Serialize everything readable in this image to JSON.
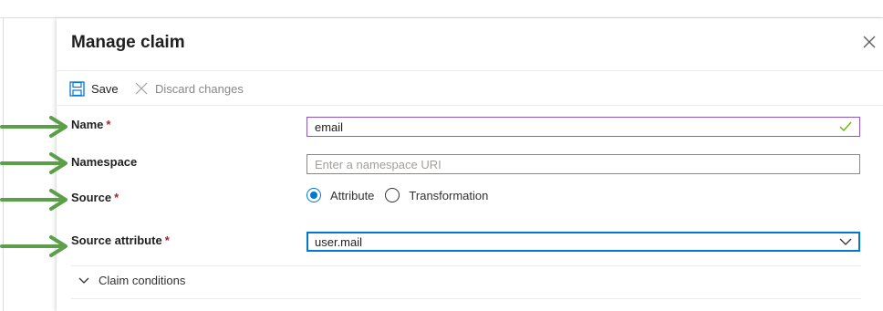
{
  "panel": {
    "title": "Manage claim"
  },
  "toolbar": {
    "save_label": "Save",
    "discard_label": "Discard changes"
  },
  "form": {
    "name": {
      "label": "Name",
      "required": "*",
      "value": "email"
    },
    "namespace": {
      "label": "Namespace",
      "placeholder": "Enter a namespace URI",
      "value": ""
    },
    "source": {
      "label": "Source",
      "required": "*",
      "options": [
        {
          "label": "Attribute",
          "selected": true
        },
        {
          "label": "Transformation",
          "selected": false
        }
      ]
    },
    "source_attribute": {
      "label": "Source attribute",
      "required": "*",
      "value": "user.mail"
    }
  },
  "claim_conditions": {
    "label": "Claim conditions"
  },
  "colors": {
    "accent": "#0078d4",
    "required": "#a4262c",
    "valid_check": "#6bb700",
    "annotation_arrow": "#5c9e4a"
  },
  "icons": [
    "save-icon",
    "discard-x-icon",
    "close-icon",
    "checkmark-icon",
    "chevron-down-icon",
    "chevron-expand-icon",
    "annotation-arrow"
  ]
}
